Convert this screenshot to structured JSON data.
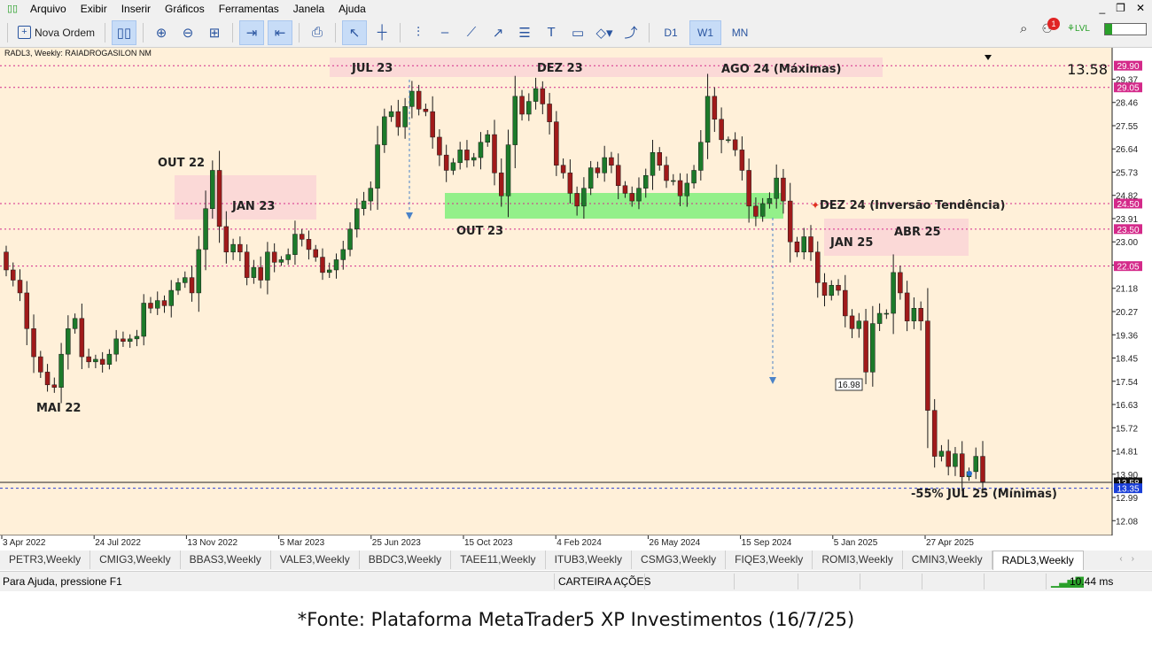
{
  "menu": {
    "items": [
      "Arquivo",
      "Exibir",
      "Inserir",
      "Gráficos",
      "Ferramentas",
      "Janela",
      "Ajuda"
    ]
  },
  "toolbar": {
    "new_order_label": "Nova Ordem",
    "timeframes": [
      "D1",
      "W1",
      "MN"
    ],
    "active_timeframe": "W1",
    "notification_count": "1",
    "lvl_label": "LVL"
  },
  "chart": {
    "header": "RADL3, Weekly:  RAIADROGASILON     NM",
    "last_price_big": "13.58",
    "x_dates": [
      "3 Apr 2022",
      "24 Jul 2022",
      "13 Nov 2022",
      "5 Mar 2023",
      "25 Jun 2023",
      "15 Oct 2023",
      "4 Feb 2024",
      "26 May 2024",
      "15 Sep 2024",
      "5 Jan 2025",
      "27 Apr 2025"
    ],
    "price_ticks": [
      "29.37",
      "28.46",
      "27.55",
      "26.64",
      "25.73",
      "24.82",
      "23.91",
      "23.00",
      "22.09",
      "21.18",
      "20.27",
      "19.36",
      "18.45",
      "17.54",
      "16.63",
      "15.72",
      "14.81",
      "13.90",
      "12.99",
      "12.08"
    ],
    "level_lines": [
      {
        "price": 29.9,
        "label": "29.90"
      },
      {
        "price": 29.05,
        "label": "29.05"
      },
      {
        "price": 24.5,
        "label": "24.50"
      },
      {
        "price": 23.5,
        "label": "23.50"
      },
      {
        "price": 22.05,
        "label": "22.05"
      }
    ],
    "current_price_label": "13.58",
    "bid_price_label": "13.35",
    "low_marker_label": "16.98",
    "annotations": {
      "mai22": "MAI 22",
      "out22": "OUT 22",
      "jan23": "JAN 23",
      "jul23": "JUL 23",
      "dez23": "DEZ 23",
      "out23": "OUT 23",
      "ago24": "AGO 24 (Máximas)",
      "dez24": "DEZ 24 (Inversão Tendência)",
      "jan25": "JAN 25",
      "abr25": "ABR 25",
      "jul25": "-55% JUL 25 (Mínimas)"
    },
    "colors": {
      "bg": "#fff0d9",
      "bull": "#1c7a2a",
      "bear": "#a01a1a",
      "zone_pink": "#fbd9d7",
      "zone_green": "#93f08a",
      "level": "#d42a8a"
    }
  },
  "chart_data": {
    "type": "candlestick",
    "title": "RADL3, Weekly",
    "ylim": [
      11.5,
      30.6
    ],
    "series": [
      {
        "name": "RADL3",
        "close": [
          21.9,
          21.5,
          21.0,
          19.6,
          18.5,
          17.9,
          17.4,
          17.3,
          18.6,
          19.6,
          20.0,
          18.5,
          18.3,
          18.4,
          18.2,
          18.6,
          19.2,
          19.1,
          19.2,
          19.3,
          20.6,
          20.4,
          20.7,
          20.5,
          21.1,
          21.4,
          21.6,
          21.0,
          22.7,
          24.3,
          25.8,
          23.6,
          22.6,
          22.9,
          22.6,
          21.6,
          22.0,
          21.5,
          22.6,
          22.2,
          22.3,
          22.5,
          23.3,
          23.1,
          22.7,
          22.4,
          21.8,
          21.9,
          22.3,
          22.7,
          23.5,
          24.3,
          24.6,
          25.1,
          26.8,
          27.9,
          28.1,
          27.5,
          28.3,
          28.9,
          28.2,
          28.1,
          27.1,
          26.4,
          25.8,
          26.1,
          26.6,
          26.2,
          26.3,
          26.9,
          27.2,
          25.7,
          24.8,
          26.8,
          28.7,
          28.0,
          28.5,
          29.0,
          28.4,
          27.7,
          26.0,
          25.7,
          24.9,
          24.4,
          25.1,
          25.9,
          25.7,
          26.3,
          26.0,
          25.2,
          24.9,
          24.6,
          25.1,
          25.6,
          26.5,
          26.0,
          25.4,
          25.4,
          24.8,
          25.3,
          25.8,
          26.9,
          28.7,
          27.8,
          27.0,
          27.0,
          26.6,
          25.8,
          24.4,
          24.0,
          24.5,
          24.7,
          25.5,
          24.6,
          23.0,
          22.6,
          23.2,
          22.6,
          21.4,
          20.9,
          21.3,
          21.1,
          20.1,
          19.6,
          19.9,
          17.9,
          19.8,
          20.2,
          20.2,
          21.8,
          21.0,
          19.9,
          20.4,
          19.9,
          16.4,
          14.6,
          14.8,
          14.2,
          14.7,
          13.8,
          14.0,
          14.6,
          13.6
        ]
      }
    ]
  },
  "tabs": {
    "items": [
      "PETR3,Weekly",
      "CMIG3,Weekly",
      "BBAS3,Weekly",
      "VALE3,Weekly",
      "BBDC3,Weekly",
      "TAEE11,Weekly",
      "ITUB3,Weekly",
      "CSMG3,Weekly",
      "FIQE3,Weekly",
      "ROMI3,Weekly",
      "CMIN3,Weekly",
      "RADL3,Weekly"
    ],
    "active_index": 11
  },
  "status": {
    "help": "Para Ajuda, pressione F1",
    "profile": "CARTEIRA AÇÕES",
    "ping": "10.44 ms"
  },
  "footnote": "*Fonte: Plataforma MetaTrader5 XP Investimentos (16/7/25)"
}
